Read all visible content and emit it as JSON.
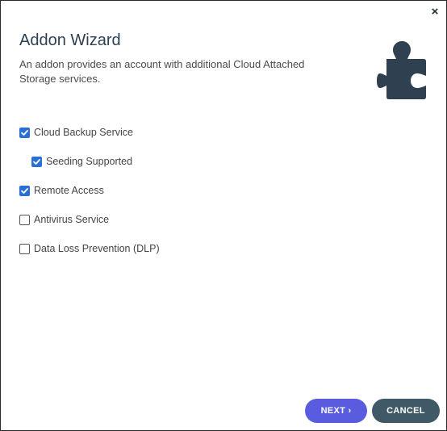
{
  "dialog": {
    "close_glyph": "×",
    "title": "Addon Wizard",
    "description": "An addon provides an account with additional Cloud Attached Storage services.",
    "icon": "puzzle-piece-icon"
  },
  "options": [
    {
      "label": "Cloud Backup Service",
      "checked": true,
      "indent": 0
    },
    {
      "label": "Seeding Supported",
      "checked": true,
      "indent": 1
    },
    {
      "label": "Remote Access",
      "checked": true,
      "indent": 0
    },
    {
      "label": "Antivirus Service",
      "checked": false,
      "indent": 0
    },
    {
      "label": "Data Loss Prevention (DLP)",
      "checked": false,
      "indent": 0
    }
  ],
  "buttons": {
    "next_label": "NEXT ›",
    "cancel_label": "CANCEL"
  },
  "colors": {
    "title": "#2f4150",
    "checkbox_checked": "#2a6fd6",
    "next_button": "#5a5ce0",
    "cancel_button": "#3f5a66",
    "icon": "#2f4150"
  }
}
